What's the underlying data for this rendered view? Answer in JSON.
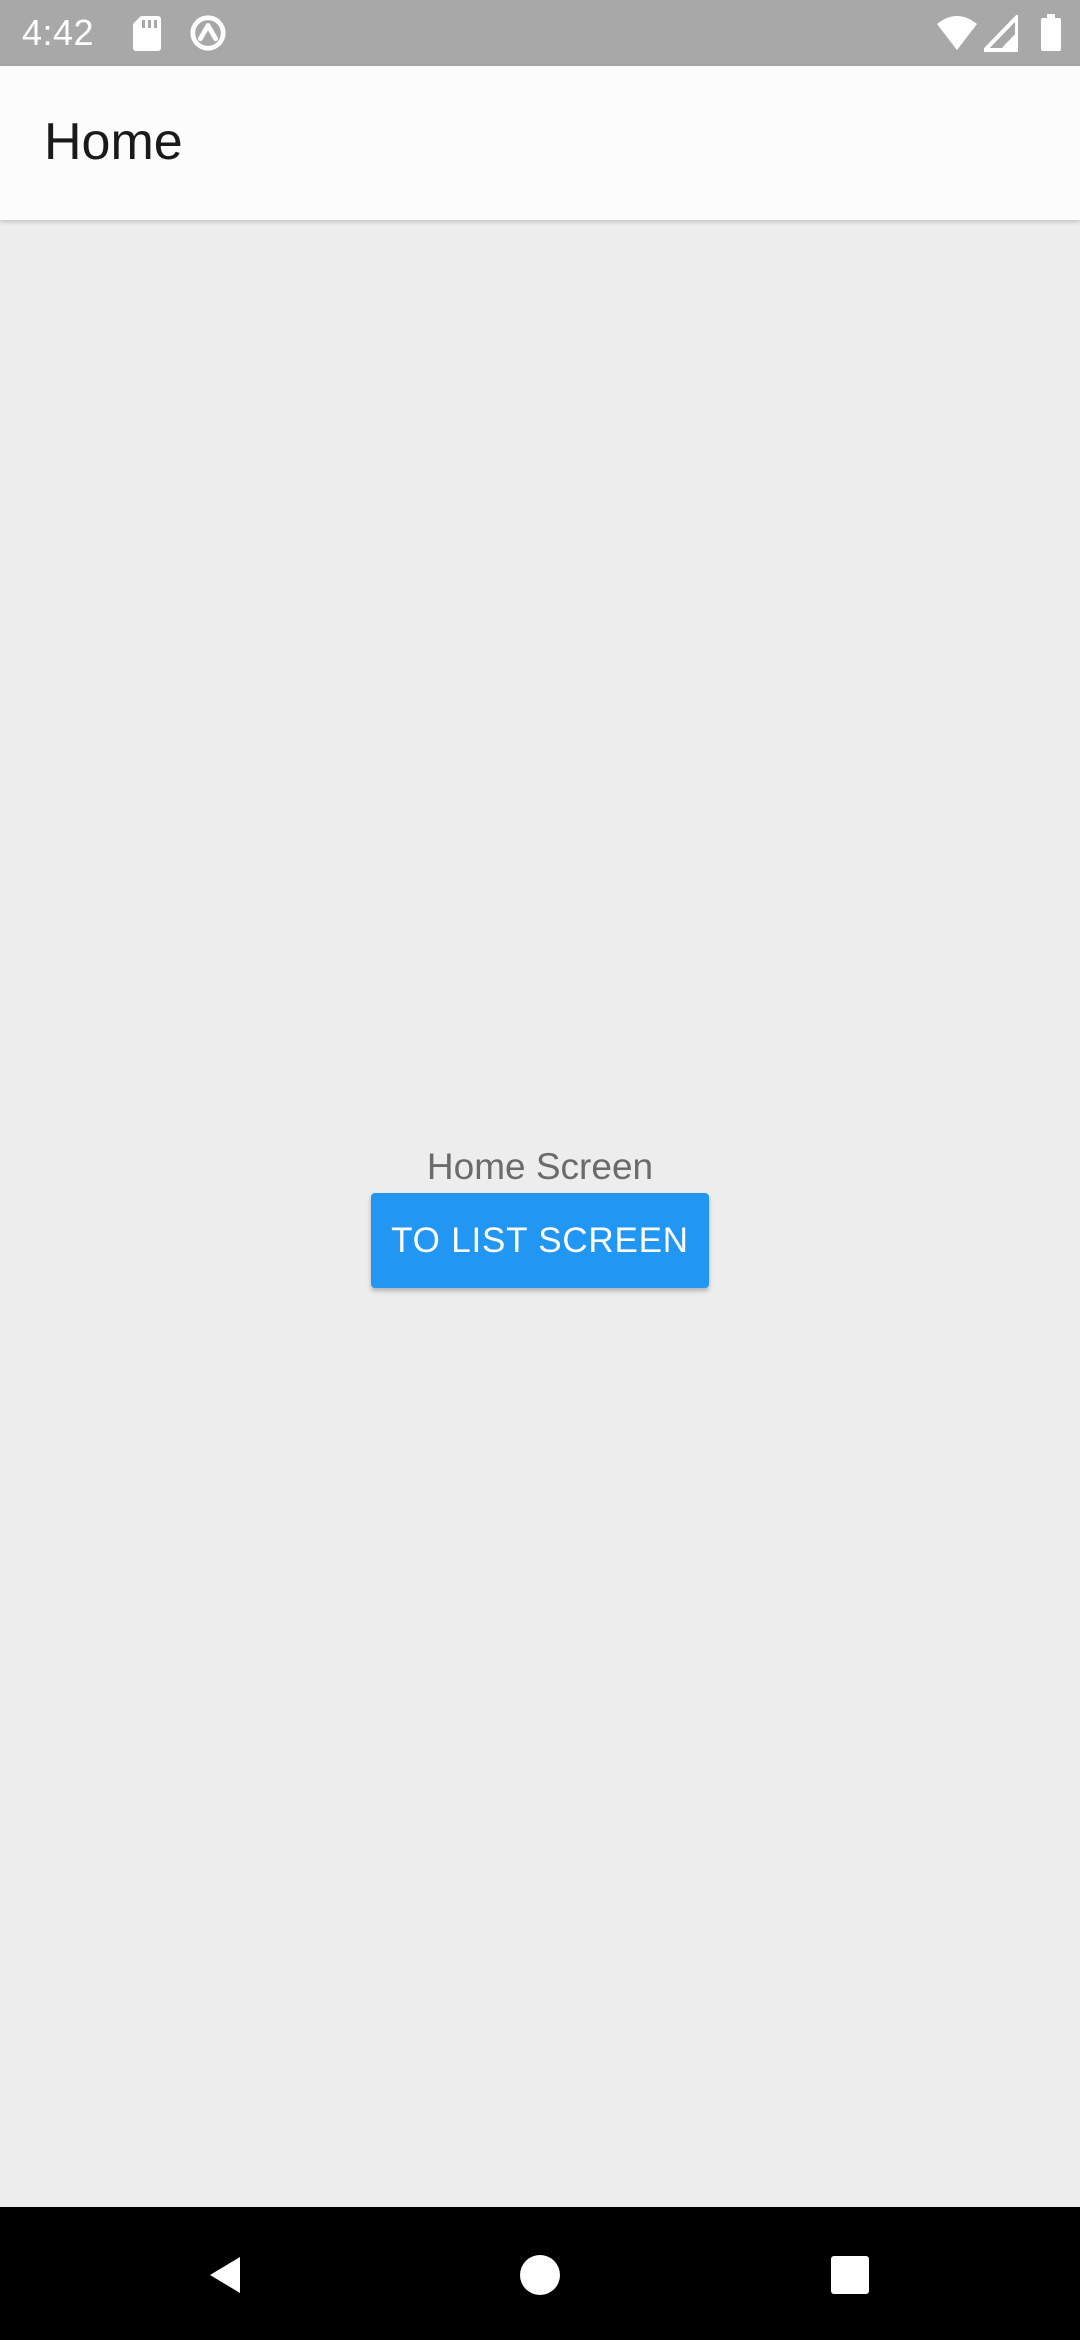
{
  "status_bar": {
    "time": "4:42",
    "icons": [
      "sd-card-icon",
      "sync-icon",
      "wifi-icon",
      "cell-signal-icon",
      "battery-icon"
    ]
  },
  "app_bar": {
    "title": "Home"
  },
  "content": {
    "label": "Home Screen",
    "button_label": "TO LIST SCREEN",
    "button_color": "#2196f3"
  },
  "nav_bar": {
    "icons": [
      "back-icon",
      "home-icon",
      "recents-icon"
    ]
  },
  "colors": {
    "status_bar": "#a8a8a8",
    "app_bar": "#fcfcfc",
    "background": "#ededed",
    "nav_bar": "#000000"
  }
}
